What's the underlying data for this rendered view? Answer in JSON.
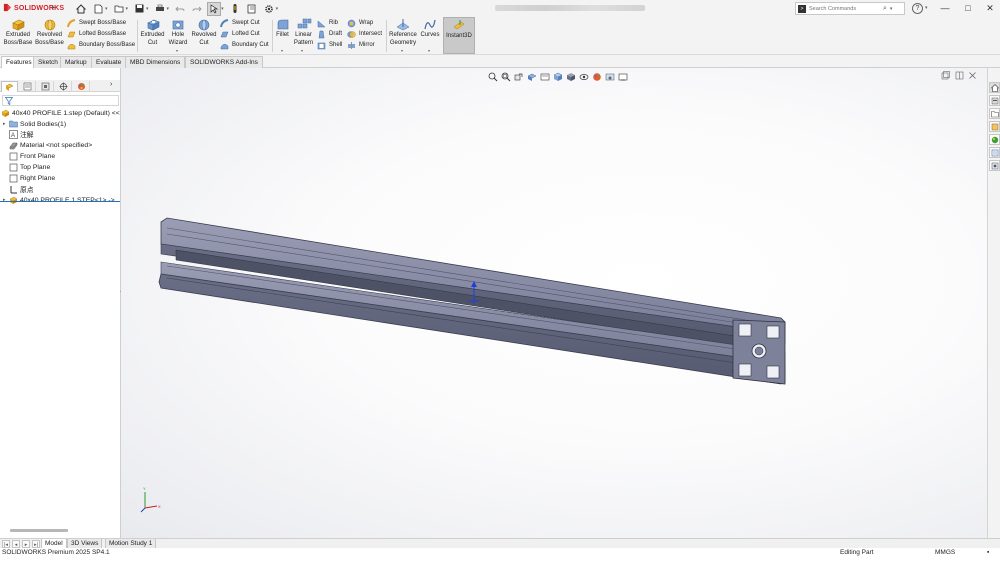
{
  "app": {
    "logo_text": "SOLIDWORKS"
  },
  "titlebar": {
    "search_placeholder": "Search Commands",
    "help_label": "?",
    "minimize_label": "—",
    "maximize_label": "□",
    "close_label": "✕"
  },
  "ribbon": {
    "extruded_boss": "Extruded\nBoss/Base",
    "revolved_boss": "Revolved\nBoss/Base",
    "swept_boss": "Swept Boss/Base",
    "lofted_boss": "Lofted Boss/Base",
    "boundary_boss": "Boundary Boss/Base",
    "extruded_cut": "Extruded\nCut",
    "hole_wizard": "Hole\nWizard",
    "revolved_cut": "Revolved\nCut",
    "swept_cut": "Swept Cut",
    "lofted_cut": "Lofted Cut",
    "boundary_cut": "Boundary Cut",
    "fillet": "Fillet",
    "linear_pattern": "Linear\nPattern",
    "rib": "Rib",
    "draft": "Draft",
    "shell": "Shell",
    "wrap": "Wrap",
    "intersect": "Intersect",
    "mirror": "Mirror",
    "reference_geometry": "Reference\nGeometry",
    "curves": "Curves",
    "instant3d": "Instant3D"
  },
  "tabs": [
    {
      "label": "Features",
      "active": true
    },
    {
      "label": "Sketch",
      "active": false
    },
    {
      "label": "Markup",
      "active": false
    },
    {
      "label": "Evaluate",
      "active": false
    },
    {
      "label": "MBD Dimensions",
      "active": false
    },
    {
      "label": "SOLIDWORKS Add-Ins",
      "active": false
    }
  ],
  "feature_tree": {
    "root": "40x40 PROFILE 1.step (Default) <<",
    "items": [
      {
        "label": "Solid Bodies(1)",
        "icon": "folder-icon",
        "expandable": true
      },
      {
        "label": "注解",
        "icon": "annotations-icon",
        "expandable": false
      },
      {
        "label": "Material <not specified>",
        "icon": "material-icon",
        "expandable": false
      },
      {
        "label": "Front Plane",
        "icon": "plane-icon",
        "expandable": false
      },
      {
        "label": "Top Plane",
        "icon": "plane-icon",
        "expandable": false
      },
      {
        "label": "Right Plane",
        "icon": "plane-icon",
        "expandable": false
      },
      {
        "label": "原点",
        "icon": "origin-icon",
        "expandable": false
      },
      {
        "label": "40x40 PROFILE 1.STEP<1> ->",
        "icon": "imported-part-icon",
        "expandable": true
      }
    ]
  },
  "bottom_tabs": [
    {
      "label": "Model",
      "active": true
    },
    {
      "label": "3D Views",
      "active": false
    },
    {
      "label": "Motion Study 1",
      "active": false
    }
  ],
  "status": {
    "product": "SOLIDWORKS Premium 2025 SP4.1",
    "mode": "Editing Part",
    "units": "MMGS"
  },
  "colors": {
    "accent": "#1a73c9",
    "brand": "#d0212a",
    "part": "#6b6f86"
  }
}
